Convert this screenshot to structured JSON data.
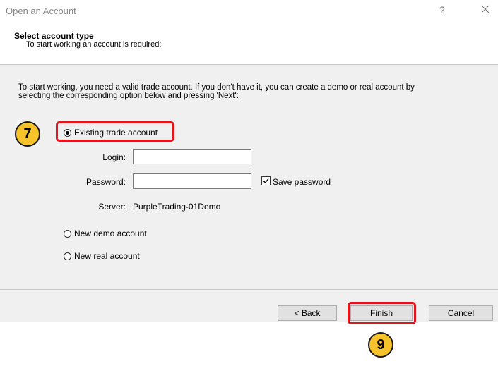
{
  "window": {
    "title": "Open an Account",
    "help_label": "?",
    "close_icon": "close-icon"
  },
  "header": {
    "title": "Select account type",
    "subtitle": "To start working an account is required:"
  },
  "main": {
    "intro_line1": "To start working, you need a valid trade account. If you don't have it, you can create a demo or real account by",
    "intro_line2": "selecting the corresponding option below and pressing 'Next':",
    "options": {
      "existing_label": "Existing trade account",
      "demo_label": "New demo account",
      "real_label": "New real account",
      "selected": "existing"
    },
    "form": {
      "login_label": "Login:",
      "login_value": "",
      "password_label": "Password:",
      "password_value": "",
      "save_password_label": "Save password",
      "save_password_checked": true,
      "server_label": "Server:",
      "server_value": "PurpleTrading-01Demo"
    }
  },
  "footer": {
    "back_label": "< Back",
    "finish_label": "Finish",
    "cancel_label": "Cancel"
  },
  "annotations": {
    "step_existing": "7",
    "step_finish": "9",
    "highlight_color": "#e4141d",
    "badge_color": "#f6c32a"
  }
}
